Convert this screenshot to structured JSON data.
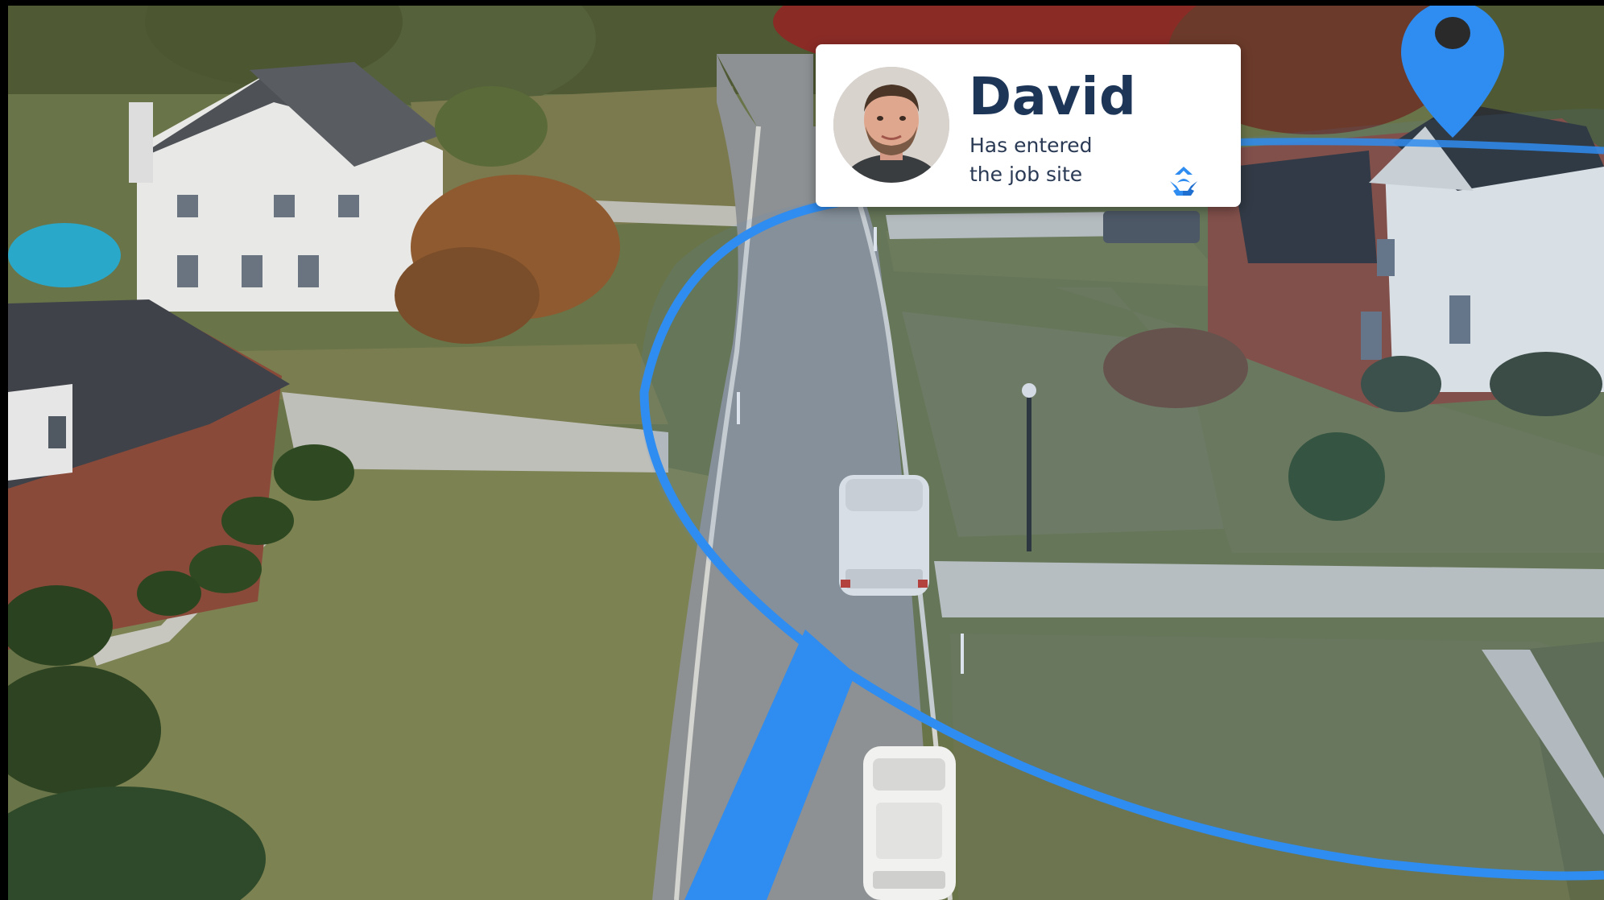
{
  "notification": {
    "name": "David",
    "message_line1": "Has entered",
    "message_line2": "the job site"
  },
  "icons": {
    "location_pin": "map-pin-icon",
    "brand_logo": "app-logo-icon",
    "avatar": "user-avatar"
  },
  "colors": {
    "accent": "#2f8cf0",
    "card_background": "#ffffff",
    "name_text": "#1d3557"
  }
}
